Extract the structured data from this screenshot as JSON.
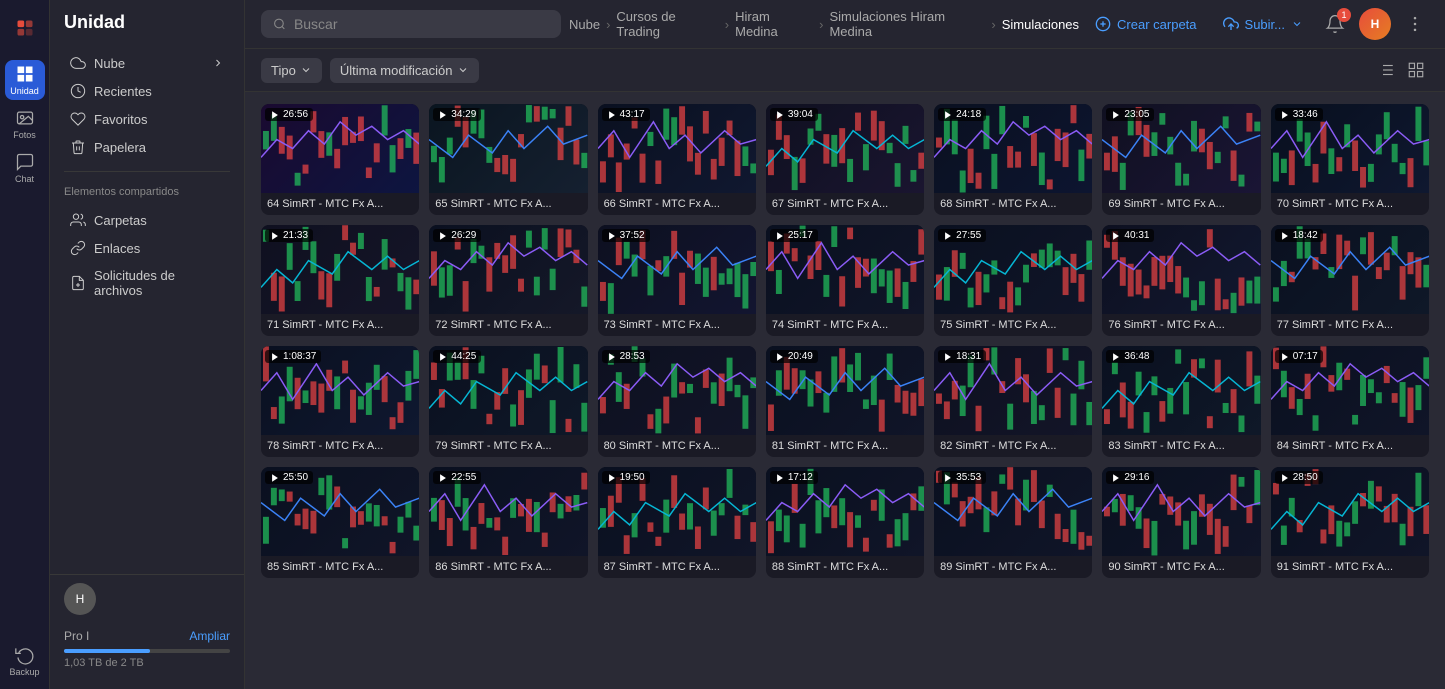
{
  "app": {
    "title": "Unidad",
    "user_avatar_initials": "H"
  },
  "sidebar": {
    "items": [
      {
        "id": "logo",
        "label": "",
        "icon": "logo",
        "active": false
      },
      {
        "id": "unidad",
        "label": "Unidad",
        "icon": "grid",
        "active": true
      },
      {
        "id": "fotos",
        "label": "Fotos",
        "icon": "image",
        "active": false
      },
      {
        "id": "chat",
        "label": "Chat",
        "icon": "chat",
        "active": false
      },
      {
        "id": "backup",
        "label": "Backup",
        "icon": "backup",
        "active": false
      }
    ]
  },
  "nav": {
    "title": "Unidad",
    "items": [
      {
        "id": "nube",
        "label": "Nube",
        "icon": "cloud",
        "has_arrow": true
      },
      {
        "id": "recientes",
        "label": "Recientes",
        "icon": "clock"
      },
      {
        "id": "favoritos",
        "label": "Favoritos",
        "icon": "heart"
      },
      {
        "id": "papelera",
        "label": "Papelera",
        "icon": "trash"
      }
    ],
    "shared_section_label": "Elementos compartidos",
    "shared_items": [
      {
        "id": "carpetas",
        "label": "Carpetas",
        "icon": "folder"
      },
      {
        "id": "enlaces",
        "label": "Enlaces",
        "icon": "link"
      },
      {
        "id": "solicitudes",
        "label": "Solicitudes de archivos",
        "icon": "file-request"
      }
    ],
    "bottom": {
      "plan_label": "Pro I",
      "ampliar_label": "Ampliar",
      "storage_used": "1,03 TB",
      "storage_total": "2 TB",
      "storage_text": "1,03 TB de 2 TB",
      "progress_percent": 52
    }
  },
  "header": {
    "search_placeholder": "Buscar",
    "breadcrumb": [
      {
        "label": "Nube"
      },
      {
        "label": "Cursos de Trading"
      },
      {
        "label": "Hiram Medina"
      },
      {
        "label": "Simulaciones Hiram Medina"
      },
      {
        "label": "Simulaciones"
      }
    ],
    "btn_crear_carpeta": "Crear carpeta",
    "btn_subir": "Subir...",
    "notification_count": "1"
  },
  "filters": {
    "tipo_label": "Tipo",
    "modificacion_label": "Última modificación"
  },
  "videos": [
    {
      "id": 64,
      "title": "64 SimRT - MTC Fx A...",
      "duration": "26:56",
      "color1": "#1a0a30",
      "color2": "#0d1540"
    },
    {
      "id": 65,
      "title": "65 SimRT - MTC Fx A...",
      "duration": "34:29",
      "color1": "#0a1520",
      "color2": "#152030"
    },
    {
      "id": 66,
      "title": "66 SimRT - MTC Fx A...",
      "duration": "43:17",
      "color1": "#0a1020",
      "color2": "#101830"
    },
    {
      "id": 67,
      "title": "67 SimRT - MTC Fx A...",
      "duration": "39:04",
      "color1": "#0f1020",
      "color2": "#1a1530"
    },
    {
      "id": 68,
      "title": "68 SimRT - MTC Fx A...",
      "duration": "24:18",
      "color1": "#0a1020",
      "color2": "#0d1530"
    },
    {
      "id": 69,
      "title": "69 SimRT - MTC Fx A...",
      "duration": "23:05",
      "color1": "#101020",
      "color2": "#1a1535"
    },
    {
      "id": 70,
      "title": "70 SimRT - MTC Fx A...",
      "duration": "33:46",
      "color1": "#080f1e",
      "color2": "#0f1830"
    },
    {
      "id": 71,
      "title": "71 SimRT - MTC Fx A...",
      "duration": "21:33",
      "color1": "#0f1020",
      "color2": "#151528"
    },
    {
      "id": 72,
      "title": "72 SimRT - MTC Fx A...",
      "duration": "26:29",
      "color1": "#0a1020",
      "color2": "#151828"
    },
    {
      "id": 73,
      "title": "73 SimRT - MTC Fx A...",
      "duration": "37:52",
      "color1": "#0d1020",
      "color2": "#121530"
    },
    {
      "id": 74,
      "title": "74 SimRT - MTC Fx A...",
      "duration": "25:17",
      "color1": "#0a1020",
      "color2": "#101528"
    },
    {
      "id": 75,
      "title": "75 SimRT - MTC Fx A...",
      "duration": "27:55",
      "color1": "#0a1020",
      "color2": "#101528"
    },
    {
      "id": 76,
      "title": "76 SimRT - MTC Fx A...",
      "duration": "40:31",
      "color1": "#0d1020",
      "color2": "#121830"
    },
    {
      "id": 77,
      "title": "77 SimRT - MTC Fx A...",
      "duration": "18:42",
      "color1": "#0a1020",
      "color2": "#0f1828"
    },
    {
      "id": 78,
      "title": "78 SimRT - MTC Fx A...",
      "duration": "1:08:37",
      "color1": "#0a1020",
      "color2": "#0f1830"
    },
    {
      "id": 79,
      "title": "79 SimRT - MTC Fx A...",
      "duration": "44:25",
      "color1": "#0a1020",
      "color2": "#0f1828"
    },
    {
      "id": 80,
      "title": "80 SimRT - MTC Fx A...",
      "duration": "28:53",
      "color1": "#0d1020",
      "color2": "#121528"
    },
    {
      "id": 81,
      "title": "81 SimRT - MTC Fx A...",
      "duration": "20:49",
      "color1": "#0a1020",
      "color2": "#101528"
    },
    {
      "id": 82,
      "title": "82 SimRT - MTC Fx A...",
      "duration": "18:31",
      "color1": "#0d1020",
      "color2": "#131528"
    },
    {
      "id": 83,
      "title": "83 SimRT - MTC Fx A...",
      "duration": "36:48",
      "color1": "#0a1020",
      "color2": "#0f1828"
    },
    {
      "id": 84,
      "title": "84 SimRT - MTC Fx A...",
      "duration": "07:17",
      "color1": "#0a1020",
      "color2": "#101528"
    },
    {
      "id": 85,
      "title": "85 SimRT - MTC Fx A...",
      "duration": "25:50",
      "color1": "#0a1020",
      "color2": "#101528"
    },
    {
      "id": 86,
      "title": "86 SimRT - MTC Fx A...",
      "duration": "22:55",
      "color1": "#0a1020",
      "color2": "#101528"
    },
    {
      "id": 87,
      "title": "87 SimRT - MTC Fx A...",
      "duration": "19:50",
      "color1": "#0a1020",
      "color2": "#101528"
    },
    {
      "id": 88,
      "title": "88 SimRT - MTC Fx A...",
      "duration": "17:12",
      "color1": "#0a1020",
      "color2": "#101528"
    },
    {
      "id": 89,
      "title": "89 SimRT - MTC Fx A...",
      "duration": "35:53",
      "color1": "#0a1020",
      "color2": "#101528"
    },
    {
      "id": 90,
      "title": "90 SimRT - MTC Fx A...",
      "duration": "29:16",
      "color1": "#0a1020",
      "color2": "#101528"
    },
    {
      "id": 91,
      "title": "91 SimRT - MTC Fx A...",
      "duration": "28:50",
      "color1": "#0a1020",
      "color2": "#101528"
    }
  ]
}
